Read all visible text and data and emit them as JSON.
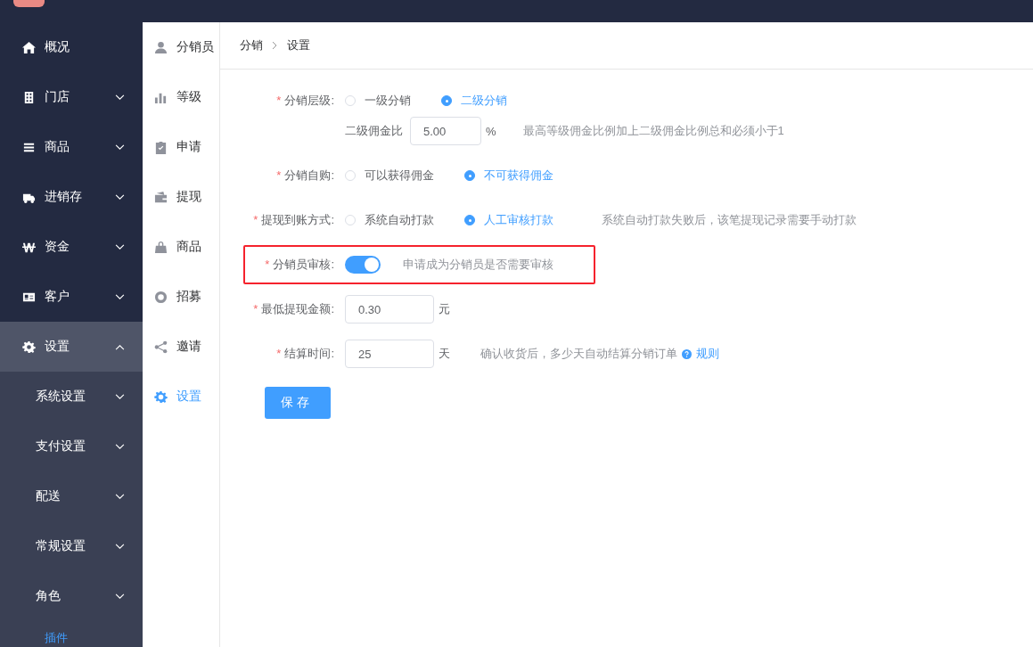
{
  "menu": [
    {
      "label": "概况",
      "kind": "leaf",
      "expanded": false
    },
    {
      "label": "门店",
      "kind": "group",
      "expanded": false
    },
    {
      "label": "商品",
      "kind": "group",
      "expanded": false
    },
    {
      "label": "进销存",
      "kind": "group",
      "expanded": false
    },
    {
      "label": "资金",
      "kind": "group",
      "expanded": false
    },
    {
      "label": "客户",
      "kind": "group",
      "expanded": false
    },
    {
      "label": "设置",
      "kind": "group",
      "expanded": true,
      "children": [
        {
          "label": "系统设置",
          "kind": "group",
          "selected": false
        },
        {
          "label": "支付设置",
          "kind": "group",
          "selected": false
        },
        {
          "label": "配送",
          "kind": "group",
          "selected": false
        },
        {
          "label": "常规设置",
          "kind": "group",
          "selected": false
        },
        {
          "label": "角色",
          "kind": "group",
          "selected": false
        },
        {
          "label": "插件",
          "kind": "leaf",
          "selected": true
        }
      ]
    }
  ],
  "submenu": [
    {
      "label": "分销员",
      "selected": false
    },
    {
      "label": "等级",
      "selected": false
    },
    {
      "label": "申请",
      "selected": false
    },
    {
      "label": "提现",
      "selected": false
    },
    {
      "label": "商品",
      "selected": false
    },
    {
      "label": "招募",
      "selected": false
    },
    {
      "label": "邀请",
      "selected": false
    },
    {
      "label": "设置",
      "selected": true
    }
  ],
  "breadcrumb": [
    "分销",
    "设置"
  ],
  "form": {
    "rows": [
      {
        "kind": "radio",
        "mark": "*",
        "label": "分销层级:",
        "options": [
          {
            "label": "一级分销",
            "selected": false
          },
          {
            "label": "二级分销",
            "selected": true
          }
        ],
        "sub": {
          "label": "二级佣金比",
          "value": "5.00",
          "unit": "%",
          "hint": "最高等级佣金比例加上二级佣金比例总和必须小于1"
        }
      },
      {
        "kind": "radio",
        "mark": "*",
        "label": "分销自购:",
        "options": [
          {
            "label": "可以获得佣金",
            "selected": false
          },
          {
            "label": "不可获得佣金",
            "selected": true
          }
        ]
      },
      {
        "kind": "radio",
        "mark": "*",
        "label": "提现到账方式:",
        "options": [
          {
            "label": "系统自动打款",
            "selected": false
          },
          {
            "label": "人工审核打款",
            "selected": true
          }
        ],
        "hint": "系统自动打款失败后，该笔提现记录需要手动打款"
      },
      {
        "kind": "toggle",
        "mark": "*",
        "label": "分销员审核:",
        "on": true,
        "highlighted": true,
        "hint": "申请成为分销员是否需要审核"
      },
      {
        "kind": "input",
        "mark": "*",
        "label": "最低提现金额:",
        "value": "0.30",
        "unit": "元"
      },
      {
        "kind": "input",
        "mark": "*",
        "label": "结算时间:",
        "value": "25",
        "unit": "天",
        "hint": "确认收货后，多少天自动结算分销订单",
        "link": "规则"
      }
    ],
    "save_button": "保存"
  }
}
